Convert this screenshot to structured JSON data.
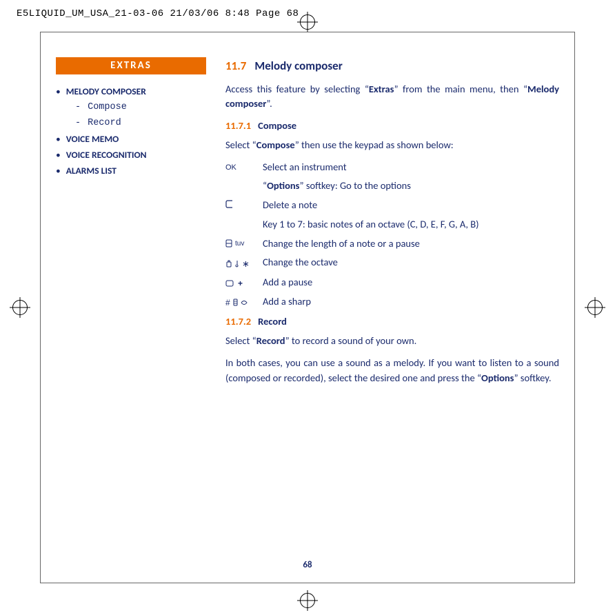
{
  "header_line": "E5LIQUID_UM_USA_21-03-06  21/03/06  8:48  Page 68",
  "sidebar": {
    "title": "EXTRAS",
    "items": [
      {
        "label": "MELODY COMPOSER",
        "sub": [
          "Compose",
          "Record"
        ]
      },
      {
        "label": "VOICE MEMO",
        "sub": []
      },
      {
        "label": "VOICE RECOGNITION",
        "sub": []
      },
      {
        "label": "ALARMS LIST",
        "sub": []
      }
    ]
  },
  "main": {
    "sec_num": "11.7",
    "sec_title": "Melody composer",
    "intro_pre": "Access this feature by selecting “",
    "intro_b1": "Extras",
    "intro_mid": "” from the main menu, then “",
    "intro_b2": "Melody composer",
    "intro_post": "”.",
    "sub1_num": "11.7.1",
    "sub1_title": "Compose",
    "sub1_intro_pre": "Select “",
    "sub1_intro_b": "Compose",
    "sub1_intro_post": "” then use the keypad as shown below:",
    "rows": {
      "ok_key": "OK",
      "ok_desc": "Select an instrument",
      "options_pre": "“",
      "options_b": "Options",
      "options_post": "” softkey: Go to the options",
      "c_desc": "Delete a note",
      "keys_desc": "Key 1 to 7: basic notes of an octave (C, D, E, F, G, A, B)",
      "tuv_label": "tuv",
      "len_desc": "Change the length of a note or a pause",
      "star_label": "∗",
      "oct_desc": "Change the octave",
      "plus_label": "+",
      "pause_desc": "Add a pause",
      "hash_label": "#",
      "sharp_desc": "Add a sharp"
    },
    "sub2_num": "11.7.2",
    "sub2_title": "Record",
    "sub2_intro_pre": "Select “",
    "sub2_intro_b": "Record",
    "sub2_intro_post": "” to record a sound of your own.",
    "closing_pre": "In both cases, you can use a sound as a melody. If you want to listen to a sound (composed or recorded), select the desired one and press the “",
    "closing_b": "Options",
    "closing_post": "” softkey."
  },
  "page_number": "68"
}
